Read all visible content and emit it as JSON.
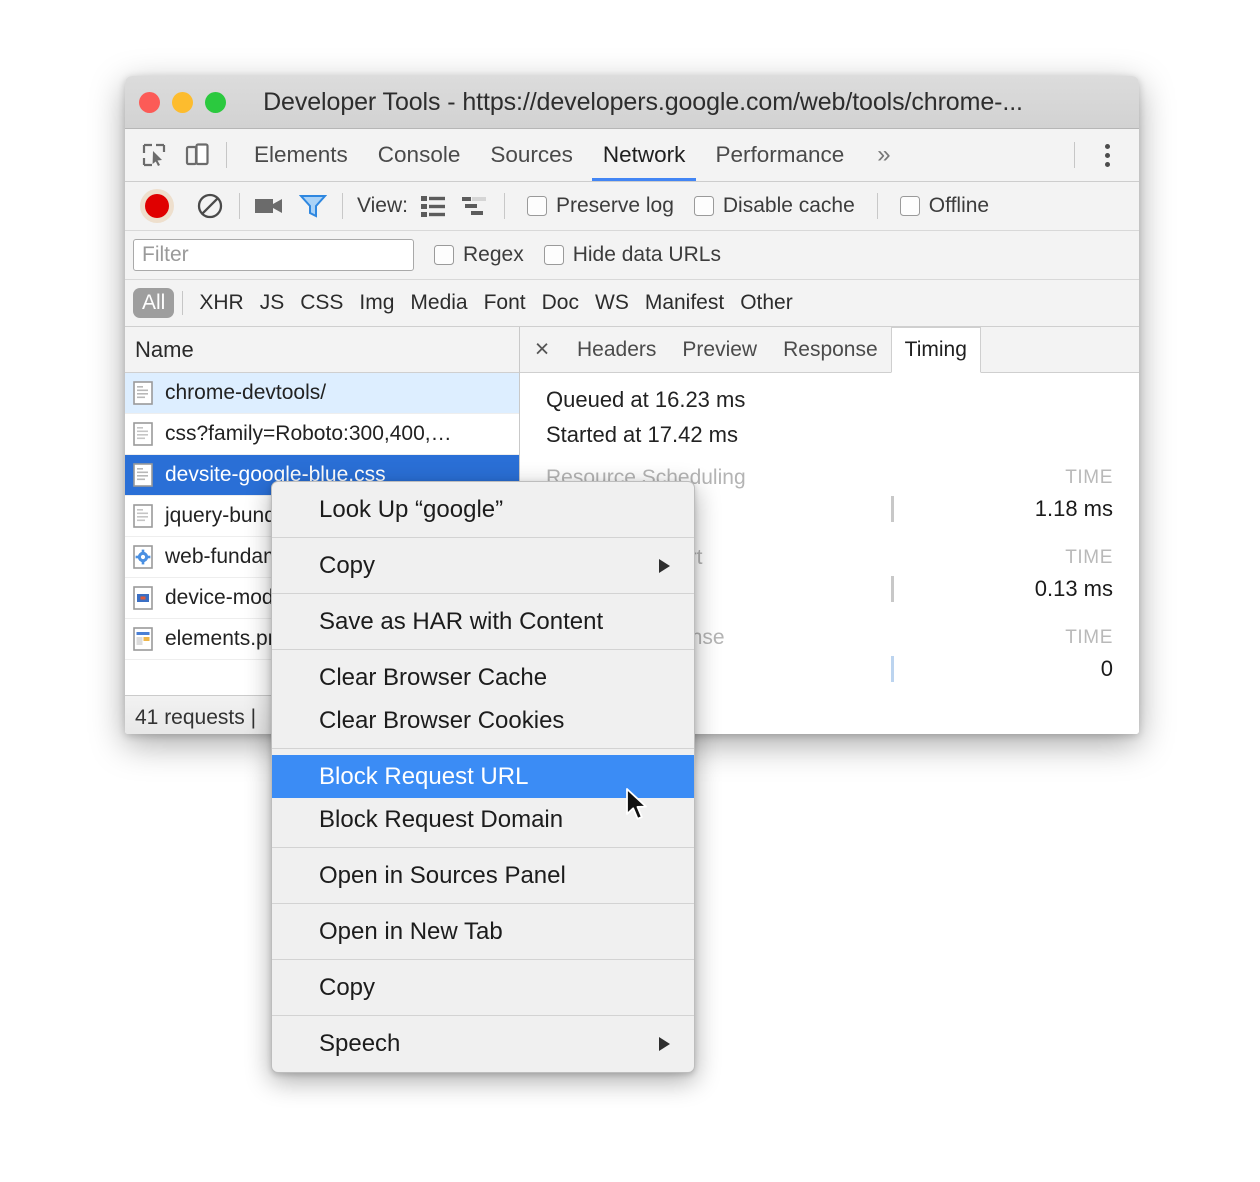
{
  "window": {
    "title": "Developer Tools - https://developers.google.com/web/tools/chrome-...",
    "traffic_lights": [
      "close",
      "minimize",
      "zoom"
    ],
    "colors": {
      "close": "#fc5b57",
      "minimize": "#fdbc2e",
      "zoom": "#2bc93f",
      "accent": "#4285f4",
      "selection_blue": "#2a6fd6",
      "menu_highlight": "#3b8cf5",
      "record_red": "#e00000"
    }
  },
  "tabbar": {
    "left_icons": [
      {
        "name": "inspect-element-icon",
        "glyph": "inspect"
      },
      {
        "name": "device-toolbar-icon",
        "glyph": "device"
      }
    ],
    "tabs": [
      {
        "label": "Elements",
        "active": false
      },
      {
        "label": "Console",
        "active": false
      },
      {
        "label": "Sources",
        "active": false
      },
      {
        "label": "Network",
        "active": true
      },
      {
        "label": "Performance",
        "active": false
      }
    ],
    "overflow_label": "»",
    "menu_icon": "kebab-menu-icon"
  },
  "network_toolbar": {
    "record_button": "record-button",
    "clear_button": "clear-button",
    "capture_screenshots_button": "camera-button",
    "filter_button": "filter-funnel-button",
    "view_label": "View:",
    "view_list_button": "list-view-button",
    "view_waterfall_button": "waterfall-view-button",
    "checkboxes": [
      {
        "label": "Preserve log",
        "checked": false
      },
      {
        "label": "Disable cache",
        "checked": false
      },
      {
        "label": "Offline",
        "checked": false
      }
    ]
  },
  "filter_row": {
    "input_placeholder": "Filter",
    "input_value": "",
    "checkboxes": [
      {
        "label": "Regex",
        "checked": false
      },
      {
        "label": "Hide data URLs",
        "checked": false
      }
    ]
  },
  "type_filters": {
    "active": "All",
    "items": [
      "XHR",
      "JS",
      "CSS",
      "Img",
      "Media",
      "Font",
      "Doc",
      "WS",
      "Manifest",
      "Other"
    ]
  },
  "request_list": {
    "column_header": "Name",
    "rows": [
      {
        "name": "chrome-devtools/",
        "icon": "document-icon",
        "state": "hover"
      },
      {
        "name": "css?family=Roboto:300,400,…",
        "icon": "document-icon",
        "state": "normal"
      },
      {
        "name": "devsite-google-blue.css",
        "icon": "document-icon",
        "state": "selected"
      },
      {
        "name": "jquery-bundle.js",
        "icon": "document-icon",
        "state": "normal"
      },
      {
        "name": "web-fundamentals.css",
        "icon": "gear-document-icon",
        "state": "normal"
      },
      {
        "name": "device-mode.png",
        "icon": "image-document-icon",
        "state": "normal"
      },
      {
        "name": "elements.png",
        "icon": "image-document-icon",
        "state": "normal"
      }
    ],
    "status": "41 requests |"
  },
  "detail_panel": {
    "close_label": "×",
    "tabs": [
      {
        "label": "Headers",
        "active": false
      },
      {
        "label": "Preview",
        "active": false
      },
      {
        "label": "Response",
        "active": false
      },
      {
        "label": "Timing",
        "active": true
      }
    ],
    "timing": {
      "queued": "Queued at 16.23 ms",
      "started": "Started at 17.42 ms",
      "time_header": "TIME",
      "sections": [
        {
          "name": "Resource Scheduling",
          "value": "1.18 ms"
        },
        {
          "name": "Connection Start",
          "value": "0.13 ms"
        },
        {
          "name": "Request/Response",
          "value": "0"
        }
      ]
    }
  },
  "context_menu": {
    "groups": [
      [
        {
          "label": "Look Up “google”",
          "submenu": false,
          "highlighted": false
        }
      ],
      [
        {
          "label": "Copy",
          "submenu": true,
          "highlighted": false
        }
      ],
      [
        {
          "label": "Save as HAR with Content",
          "submenu": false,
          "highlighted": false
        }
      ],
      [
        {
          "label": "Clear Browser Cache",
          "submenu": false,
          "highlighted": false
        },
        {
          "label": "Clear Browser Cookies",
          "submenu": false,
          "highlighted": false
        }
      ],
      [
        {
          "label": "Block Request URL",
          "submenu": false,
          "highlighted": true
        },
        {
          "label": "Block Request Domain",
          "submenu": false,
          "highlighted": false
        }
      ],
      [
        {
          "label": "Open in Sources Panel",
          "submenu": false,
          "highlighted": false
        }
      ],
      [
        {
          "label": "Open in New Tab",
          "submenu": false,
          "highlighted": false
        }
      ],
      [
        {
          "label": "Copy",
          "submenu": false,
          "highlighted": false
        }
      ],
      [
        {
          "label": "Speech",
          "submenu": true,
          "highlighted": false
        }
      ]
    ]
  }
}
